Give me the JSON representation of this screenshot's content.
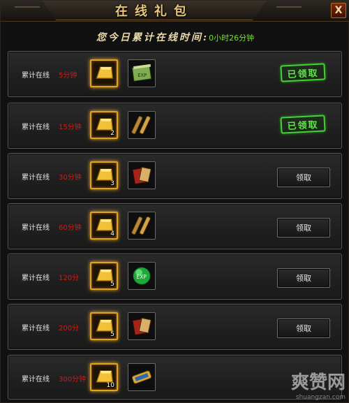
{
  "window": {
    "title": "在线礼包",
    "close_label": "X"
  },
  "online_time": {
    "label": "您今日累计在线时间:",
    "value": "0小时26分钟"
  },
  "rewards": [
    {
      "condition_label": "累计在线",
      "condition_value": "5分钟",
      "gold_count": "",
      "item_icon": "experience-scroll-icon",
      "status": "claimed",
      "action_label": "已领取"
    },
    {
      "condition_label": "累计在线",
      "condition_value": "15分钟",
      "gold_count": "2",
      "item_icon": "scroll-bundle-icon",
      "status": "claimed",
      "action_label": "已领取"
    },
    {
      "condition_label": "累计在线",
      "condition_value": "30分钟",
      "gold_count": "3",
      "item_icon": "red-book-icon",
      "status": "available",
      "action_label": "领取"
    },
    {
      "condition_label": "累计在线",
      "condition_value": "60分钟",
      "gold_count": "4",
      "item_icon": "scroll-bundle-icon",
      "status": "available",
      "action_label": "领取"
    },
    {
      "condition_label": "累计在线",
      "condition_value": "120分",
      "gold_count": "5",
      "item_icon": "exp-orb-icon",
      "status": "available",
      "action_label": "领取"
    },
    {
      "condition_label": "累计在线",
      "condition_value": "200分",
      "gold_count": "5",
      "item_icon": "red-book-icon",
      "status": "available",
      "action_label": "领取"
    },
    {
      "condition_label": "累计在线",
      "condition_value": "300分钟",
      "gold_count": "10",
      "item_icon": "gold-scroll-icon",
      "status": "none",
      "action_label": ""
    }
  ],
  "watermark": {
    "text": "爽赞网",
    "url": "shuangzan.com"
  },
  "colors": {
    "gold_border": "#e4a21c",
    "condition_value": "#d21c14",
    "claimed_green": "#46d03c",
    "online_value": "#7adf3a"
  }
}
